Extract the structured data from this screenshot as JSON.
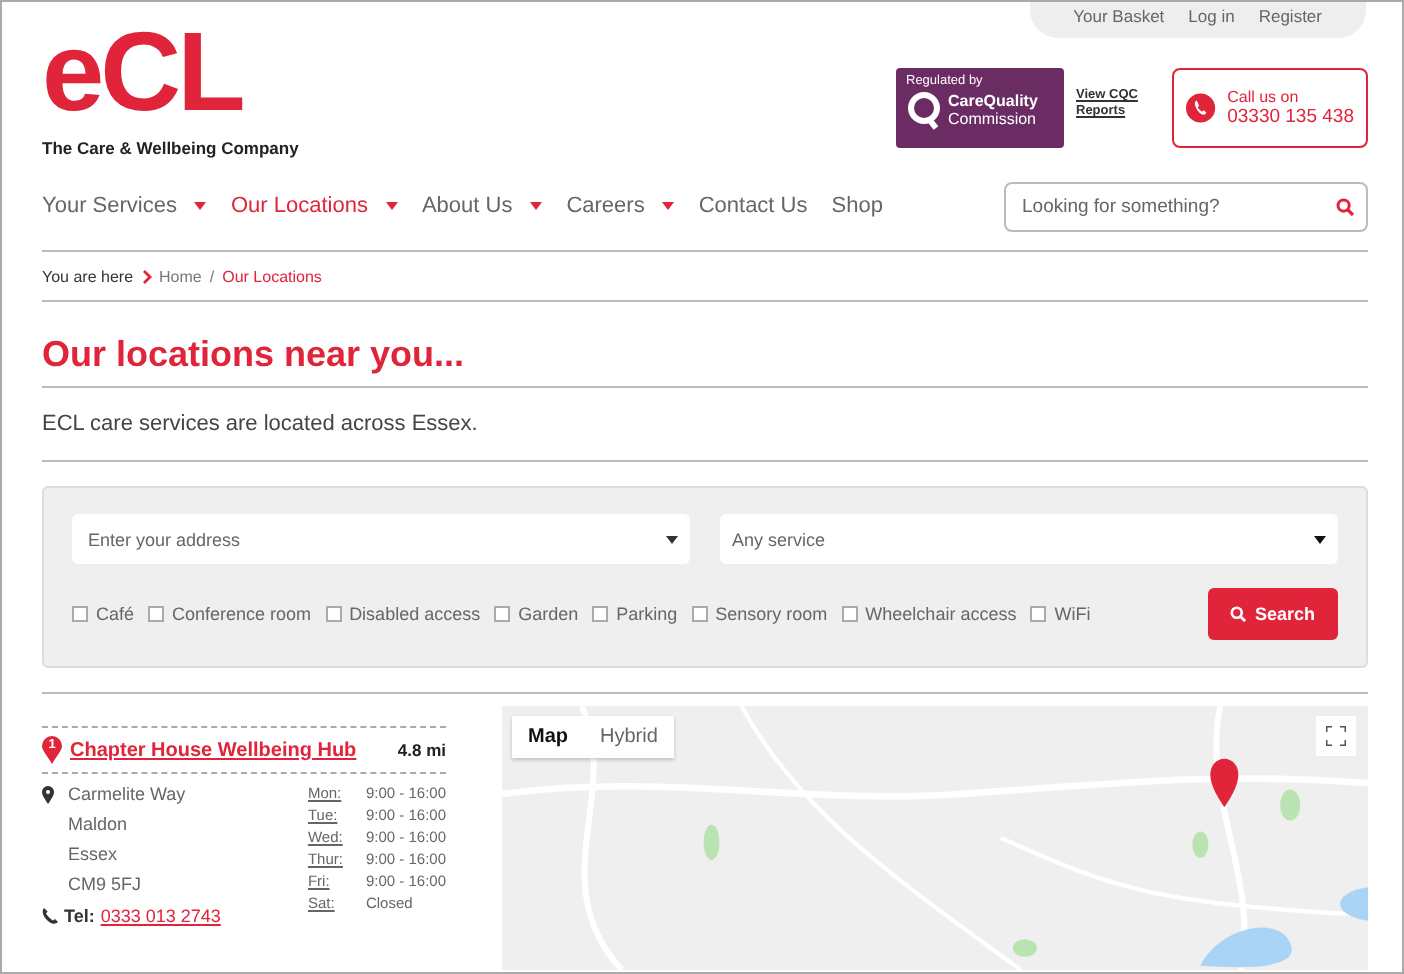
{
  "top_links": [
    "Your Basket",
    "Log in",
    "Register"
  ],
  "logo": {
    "text": "eCL",
    "tagline": "The Care & Wellbeing Company"
  },
  "cqc": {
    "regulated": "Regulated by",
    "name_1": "CareQuality",
    "name_2": "Commission",
    "link": "View CQC Reports"
  },
  "call": {
    "label": "Call us on",
    "number": "03330 135 438"
  },
  "nav": [
    {
      "label": "Your Services",
      "dropdown": true,
      "selected": false
    },
    {
      "label": "Our Locations",
      "dropdown": true,
      "selected": true
    },
    {
      "label": "About Us",
      "dropdown": true,
      "selected": false
    },
    {
      "label": "Careers",
      "dropdown": true,
      "selected": false
    },
    {
      "label": "Contact Us",
      "dropdown": false,
      "selected": false
    },
    {
      "label": "Shop",
      "dropdown": false,
      "selected": false
    }
  ],
  "search": {
    "placeholder": "Looking for something?"
  },
  "breadcrumb": {
    "label": "You are here",
    "separator": "/",
    "items": [
      "Home",
      "Our Locations"
    ]
  },
  "heading": "Our locations near you...",
  "intro": "ECL care services are located across Essex.",
  "finder": {
    "address_placeholder": "Enter your address",
    "service": "Any service",
    "filters": [
      {
        "label": "Café",
        "checked": false
      },
      {
        "label": "Conference room",
        "checked": false
      },
      {
        "label": "Disabled access",
        "checked": false
      },
      {
        "label": "Garden",
        "checked": false
      },
      {
        "label": "Parking",
        "checked": false
      },
      {
        "label": "Sensory room",
        "checked": false
      },
      {
        "label": "Wheelchair access",
        "checked": false
      },
      {
        "label": "WiFi",
        "checked": false
      }
    ],
    "button": "Search"
  },
  "result": {
    "number": "1",
    "name": "Chapter House Wellbeing Hub",
    "distance": "4.8 mi",
    "address": [
      "Carmelite Way",
      "Maldon",
      "Essex",
      "CM9 5FJ"
    ],
    "hours": [
      {
        "day": "Mon:",
        "time": "9:00 - 16:00"
      },
      {
        "day": "Tue:",
        "time": "9:00 - 16:00"
      },
      {
        "day": "Wed:",
        "time": "9:00 - 16:00"
      },
      {
        "day": "Thur:",
        "time": "9:00 - 16:00"
      },
      {
        "day": "Fri:",
        "time": "9:00 - 16:00"
      },
      {
        "day": "Sat:",
        "time": "Closed"
      }
    ],
    "tel_label": "Tel:",
    "tel": "0333 013 2743"
  },
  "map": {
    "kind": "picture",
    "types": [
      {
        "label": "Map",
        "selected": true
      },
      {
        "label": "Hybrid",
        "selected": false
      }
    ]
  }
}
